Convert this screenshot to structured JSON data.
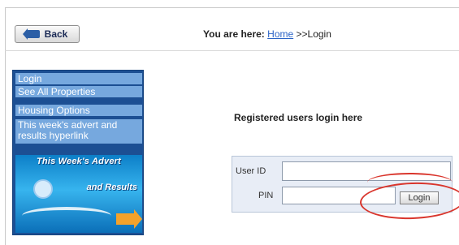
{
  "header": {
    "back_label": "Back",
    "breadcrumb": {
      "prefix": "You are here:",
      "home_link": "Home",
      "current": ">>Login"
    }
  },
  "sidebar": {
    "items": [
      {
        "label": "Login"
      },
      {
        "label": "See All Properties"
      },
      {
        "label": "Housing Options"
      },
      {
        "label": "This week's advert and results hyperlink"
      }
    ],
    "promo": {
      "title": "This Week's Advert",
      "subtitle": "and Results"
    }
  },
  "main": {
    "heading": "Registered users login here",
    "form": {
      "user_id_label": "User ID",
      "user_id_value": "",
      "pin_label": "PIN",
      "pin_value": "",
      "login_label": "Login"
    }
  },
  "colors": {
    "sidebar_bg": "#1c4f93",
    "nav_item_bg": "#76a8de",
    "annotation": "#d9352c"
  }
}
